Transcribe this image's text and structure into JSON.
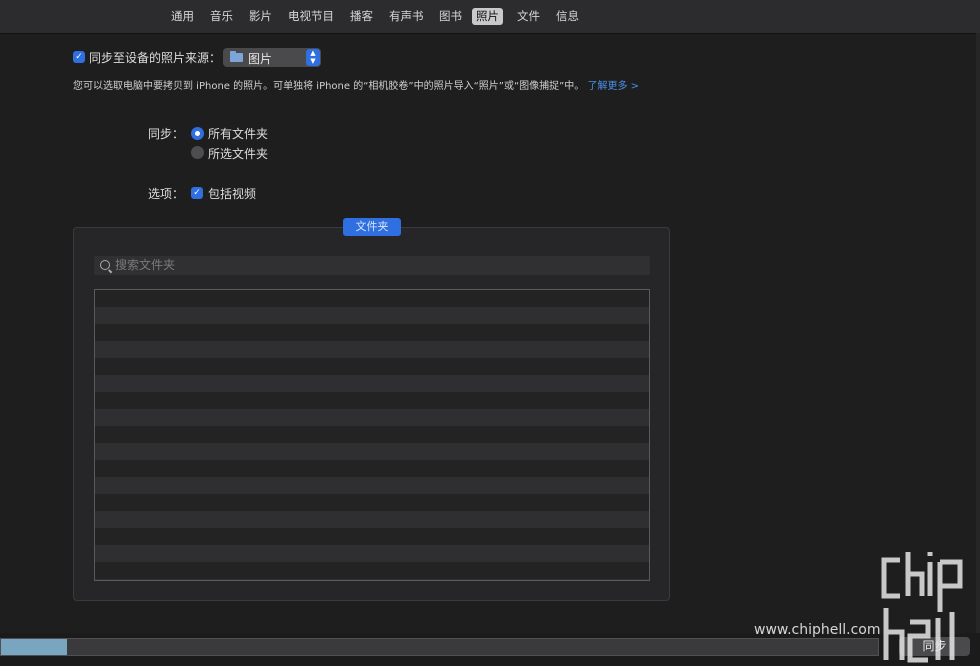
{
  "tabs": [
    {
      "label": "通用",
      "active": false
    },
    {
      "label": "音乐",
      "active": false
    },
    {
      "label": "影片",
      "active": false
    },
    {
      "label": "电视节目",
      "active": false
    },
    {
      "label": "播客",
      "active": false
    },
    {
      "label": "有声书",
      "active": false
    },
    {
      "label": "图书",
      "active": false
    },
    {
      "label": "照片",
      "active": true
    },
    {
      "label": "文件",
      "active": false
    },
    {
      "label": "信息",
      "active": false
    }
  ],
  "sync_source": {
    "checked": true,
    "label": "同步至设备的照片来源：",
    "selected": "图片"
  },
  "description": {
    "text": "您可以选取电脑中要拷贝到 iPhone 的照片。可单独将 iPhone 的“相机胶卷”中的照片导入“照片”或“图像捕捉”中。",
    "link": "了解更多 >"
  },
  "sync_mode": {
    "label": "同步：",
    "options": [
      {
        "label": "所有文件夹",
        "selected": true
      },
      {
        "label": "所选文件夹",
        "selected": false
      }
    ]
  },
  "options_section": {
    "label": "选项：",
    "include_videos_label": "包括视频",
    "include_videos_checked": true
  },
  "folders": {
    "title": "文件夹",
    "search_placeholder": "搜索文件夹",
    "search_value": ""
  },
  "capacity": {
    "used_fraction": 0.075
  },
  "sync_button": {
    "label": "同步"
  },
  "watermark": {
    "url": "www.chiphell.com",
    "logo_text": "chip hell"
  },
  "colors": {
    "accent": "#2f6fe0",
    "link": "#4a90e8",
    "capacity_fill": "#78a6c0"
  },
  "icons": {
    "checkbox": "checkmark-icon",
    "popup_folder": "folder-icon",
    "popup_stepper": "chevron-updown-icon",
    "search": "magnifier-icon"
  }
}
